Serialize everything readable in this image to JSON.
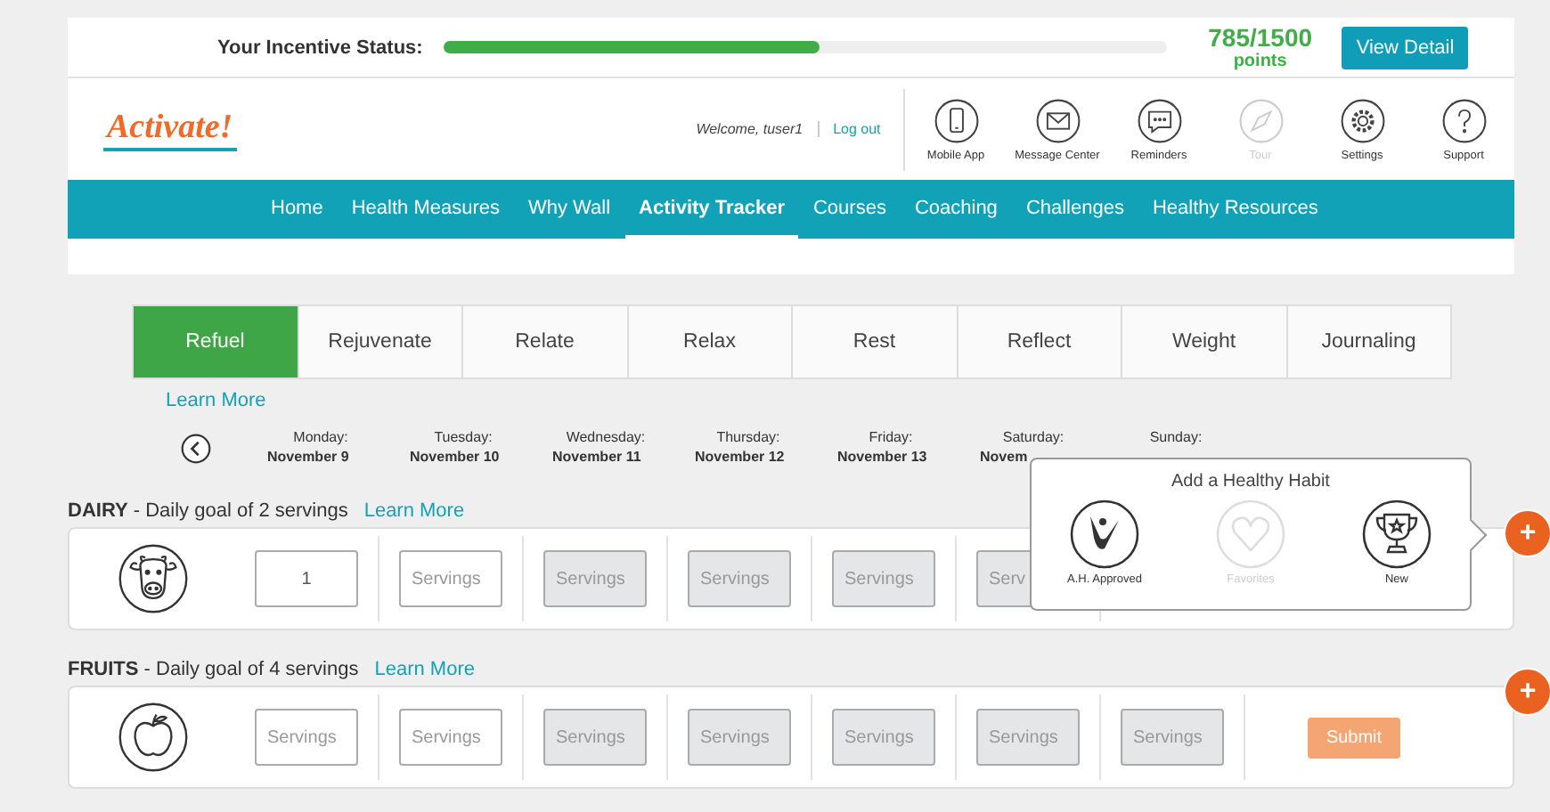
{
  "incentive": {
    "label": "Your Incentive Status:",
    "level": 0.52,
    "points": "785/1500",
    "unit": "points",
    "button": "View Detail"
  },
  "header": {
    "logo": "Activate!",
    "welcome": "Welcome, tuser1",
    "logout": "Log out",
    "tools": [
      {
        "label": "Mobile App",
        "kind": "phone",
        "disabled": false
      },
      {
        "label": "Message Center",
        "kind": "mail",
        "disabled": false
      },
      {
        "label": "Reminders",
        "kind": "chat",
        "disabled": false
      },
      {
        "label": "Tour",
        "kind": "compass",
        "disabled": true
      },
      {
        "label": "Settings",
        "kind": "gear",
        "disabled": false
      },
      {
        "label": "Support",
        "kind": "help",
        "disabled": false
      }
    ]
  },
  "nav": [
    {
      "label": "Home",
      "selected": false
    },
    {
      "label": "Health Measures",
      "selected": false
    },
    {
      "label": "Why Wall",
      "selected": false
    },
    {
      "label": "Activity Tracker",
      "selected": true
    },
    {
      "label": "Courses",
      "selected": false
    },
    {
      "label": "Coaching",
      "selected": false
    },
    {
      "label": "Challenges",
      "selected": false
    },
    {
      "label": "Healthy Resources",
      "selected": false
    }
  ],
  "tabs": [
    {
      "label": "Refuel",
      "selected": true
    },
    {
      "label": "Rejuvenate",
      "selected": false
    },
    {
      "label": "Relate",
      "selected": false
    },
    {
      "label": "Relax",
      "selected": false
    },
    {
      "label": "Rest",
      "selected": false
    },
    {
      "label": "Reflect",
      "selected": false
    },
    {
      "label": "Weight",
      "selected": false
    },
    {
      "label": "Journaling",
      "selected": false
    }
  ],
  "learn_more": "Learn More",
  "days": [
    {
      "day": "Monday:",
      "date": "November 9"
    },
    {
      "day": "Tuesday:",
      "date": "November 10"
    },
    {
      "day": "Wednesday:",
      "date": "November 11"
    },
    {
      "day": "Thursday:",
      "date": "November 12"
    },
    {
      "day": "Friday:",
      "date": "November 13"
    },
    {
      "day": "Saturday:",
      "date": "Novem"
    },
    {
      "day": "Sunday:"
    }
  ],
  "sections": [
    {
      "heading": "**DAIRY** - Daily goal of 2 servings",
      "link": "Learn More",
      "kind": "cow",
      "add": "+",
      "cells": [
        {
          "value": "1",
          "disabled": false
        },
        {
          "placeholder": "Servings",
          "disabled": false
        },
        {
          "placeholder": "Servings",
          "disabled": true
        },
        {
          "placeholder": "Servings",
          "disabled": true
        },
        {
          "placeholder": "Servings",
          "disabled": true
        },
        {
          "placeholder": "Serv",
          "disabled": true
        }
      ]
    },
    {
      "heading": "**FRUITS** - Daily goal of 4 servings",
      "link": "Learn More",
      "kind": "apple",
      "add": "+",
      "submit": "Submit",
      "cells": [
        {
          "placeholder": "Servings",
          "disabled": false
        },
        {
          "placeholder": "Servings",
          "disabled": false
        },
        {
          "placeholder": "Servings",
          "disabled": true
        },
        {
          "placeholder": "Servings",
          "disabled": true
        },
        {
          "placeholder": "Servings",
          "disabled": true
        },
        {
          "placeholder": "Servings",
          "disabled": true
        },
        {
          "placeholder": "Servings",
          "disabled": true
        }
      ]
    }
  ],
  "popup": {
    "title": "Add a Healthy Habit",
    "options": [
      {
        "label": "A.H. Approved",
        "kind": "approved",
        "disabled": false
      },
      {
        "label": "Favorites",
        "kind": "heart",
        "disabled": true
      },
      {
        "label": "New",
        "kind": "trophy",
        "disabled": false
      }
    ]
  }
}
